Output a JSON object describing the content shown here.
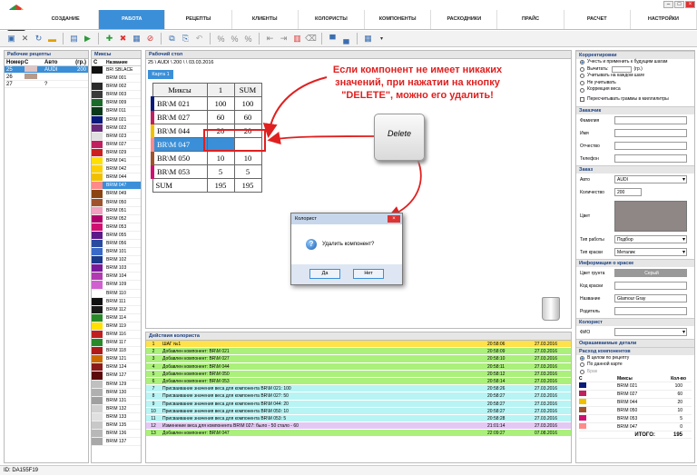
{
  "menu": [
    "СОЗДАНИЕ",
    "РАБОТА",
    "РЕЦЕПТЫ",
    "КЛИЕНТЫ",
    "КОЛОРИСТЫ",
    "КОМПОНЕНТЫ",
    "РАСХОДНИКИ",
    "ПРАЙС",
    "РАСЧЕТ",
    "НАСТРОЙКИ"
  ],
  "recipes": {
    "title": "Рабочие рецепты",
    "headers": [
      "Номер",
      "С",
      "Авто",
      "(гр.)"
    ],
    "rows": [
      {
        "num": "25",
        "auto": "AUDI",
        "g": "200",
        "color": "#e0c4c4"
      },
      {
        "num": "26",
        "auto": "",
        "g": "",
        "color": "#b69a8a"
      },
      {
        "num": "27",
        "auto": "?",
        "g": "",
        "color": "#ffffff"
      }
    ]
  },
  "mixes": {
    "title": "Миксы",
    "headers": [
      "С",
      "Название"
    ],
    "rows": [
      {
        "n": "BR\\ SBLACE",
        "c": "#111111"
      },
      {
        "n": "BR\\M 001",
        "c": "#ffffff"
      },
      {
        "n": "BR\\M 002",
        "c": "#2a2a2a"
      },
      {
        "n": "BR\\M 003",
        "c": "#3a3a3a"
      },
      {
        "n": "BR\\M 009",
        "c": "#1a6b2a"
      },
      {
        "n": "BR\\M 011",
        "c": "#0a3a1a"
      },
      {
        "n": "BR\\M 021",
        "c": "#0a1a7a"
      },
      {
        "n": "BR\\M 022",
        "c": "#6a2a7a"
      },
      {
        "n": "BR\\M 023",
        "c": "#e0e0e0"
      },
      {
        "n": "BR\\M 027",
        "c": "#c02060"
      },
      {
        "n": "BR\\M 029",
        "c": "#cc2020"
      },
      {
        "n": "BR\\M 041",
        "c": "#ffe000"
      },
      {
        "n": "BR\\M 042",
        "c": "#ffd000"
      },
      {
        "n": "BR\\M 044",
        "c": "#f0c000"
      },
      {
        "n": "BR\\M 047",
        "c": "#ff8a8a",
        "sel": true
      },
      {
        "n": "BR\\M 049",
        "c": "#8b4513"
      },
      {
        "n": "BR\\M 050",
        "c": "#a0522d"
      },
      {
        "n": "BR\\M 051",
        "c": "#f0a0c0"
      },
      {
        "n": "BR\\M 052",
        "c": "#b0006a"
      },
      {
        "n": "BR\\M 053",
        "c": "#d01070"
      },
      {
        "n": "BR\\M 055",
        "c": "#5a1a8a"
      },
      {
        "n": "BR\\M 056",
        "c": "#2a4aa0"
      },
      {
        "n": "BR\\M 101",
        "c": "#3a6ac8"
      },
      {
        "n": "BR\\M 102",
        "c": "#1a3a8a"
      },
      {
        "n": "BR\\M 103",
        "c": "#7a1a9a"
      },
      {
        "n": "BR\\M 104",
        "c": "#b03ab0"
      },
      {
        "n": "BR\\M 109",
        "c": "#d060d0"
      },
      {
        "n": "BR\\M 110",
        "c": "#ffffff"
      },
      {
        "n": "BR\\M 111",
        "c": "#111111"
      },
      {
        "n": "BR\\M 112",
        "c": "#1a1a1a"
      },
      {
        "n": "BR\\M 114",
        "c": "#2a8a2a"
      },
      {
        "n": "BR\\M 119",
        "c": "#ffe000"
      },
      {
        "n": "BR\\M 116",
        "c": "#c02020"
      },
      {
        "n": "BR\\M 117",
        "c": "#2a8a2a"
      },
      {
        "n": "BR\\M 118",
        "c": "#b01a1a"
      },
      {
        "n": "BR\\M 121",
        "c": "#cc6a00"
      },
      {
        "n": "BR\\M 124",
        "c": "#8a1a1a"
      },
      {
        "n": "BR\\M 127",
        "c": "#5a0a0a"
      },
      {
        "n": "BR\\M 129",
        "c": "#c0c0c0"
      },
      {
        "n": "BR\\M 130",
        "c": "#b0b0b0"
      },
      {
        "n": "BR\\M 131",
        "c": "#a0a0a0"
      },
      {
        "n": "BR\\M 132",
        "c": "#d0d0d0"
      },
      {
        "n": "BR\\M 133",
        "c": "#e0e0e0"
      },
      {
        "n": "BR\\M 135",
        "c": "#c8c8c8"
      },
      {
        "n": "BR\\M 136",
        "c": "#b8b8b8"
      },
      {
        "n": "BR\\M 137",
        "c": "#a8a8a8"
      }
    ]
  },
  "desk": {
    "title": "Рабочий стол",
    "path": "25 \\ AUDI \\ 200 \\  \\ 03.03.2016",
    "card": "Карта 1",
    "table": {
      "h": [
        "Миксы",
        "1",
        "SUM"
      ],
      "rows": [
        [
          "BR\\M 021",
          "100",
          "100",
          "#0a1a7a"
        ],
        [
          "BR\\M 027",
          "60",
          "60",
          "#c02060"
        ],
        [
          "BR\\M 044",
          "20",
          "20",
          "#f0c000"
        ],
        [
          "BR\\M 047",
          "",
          "",
          "#ff8a8a"
        ],
        [
          "BR\\M 050",
          "10",
          "10",
          "#a0522d"
        ],
        [
          "BR\\M 053",
          "5",
          "5",
          "#d01070"
        ]
      ],
      "sum": [
        "SUM",
        "195",
        "195"
      ]
    }
  },
  "callout": "Если компонент не имеет никаких значений, при нажатии на кнопку \"DELETE\", можно его удалить!",
  "delkey": "Delete",
  "dialog": {
    "title": "Колорист",
    "text": "Удалить компонент?",
    "yes": "Да",
    "no": "Нет"
  },
  "actions": {
    "title": "Действия колориста",
    "rows": [
      [
        "1",
        "ШАГ №1",
        "20:58:06",
        "27.03.2016",
        "#ffe14a"
      ],
      [
        "2",
        "Добавлен компонент: BR\\M 021",
        "20:58:09",
        "27.03.2016",
        "#aaf07a"
      ],
      [
        "3",
        "Добавлен компонент: BR\\M 027",
        "20:58:10",
        "27.03.2016",
        "#aaf07a"
      ],
      [
        "4",
        "Добавлен компонент: BR\\M 044",
        "20:58:11",
        "27.03.2016",
        "#aaf07a"
      ],
      [
        "5",
        "Добавлен компонент: BR\\M 050",
        "20:58:12",
        "27.03.2016",
        "#aaf07a"
      ],
      [
        "6",
        "Добавлен компонент: BR\\M 053",
        "20:58:14",
        "27.03.2016",
        "#aaf07a"
      ],
      [
        "7",
        "Присваивание значения веса для компонента BR\\M 021: 100",
        "20:58:26",
        "27.03.2016",
        "#b8f4f4"
      ],
      [
        "8",
        "Присваивание значения веса для компонента BR\\M 027: 50",
        "20:58:27",
        "27.03.2016",
        "#b8f4f4"
      ],
      [
        "9",
        "Присваивание значения веса для компонента BR\\M 044: 20",
        "20:58:27",
        "27.03.2016",
        "#b8f4f4"
      ],
      [
        "10",
        "Присваивание значения веса для компонента BR\\M 050: 10",
        "20:58:27",
        "27.03.2016",
        "#b8f4f4"
      ],
      [
        "11",
        "Присваивание значения веса для компонента BR\\M 053: 5",
        "20:58:28",
        "27.03.2016",
        "#b8f4f4"
      ],
      [
        "12",
        "Изменение веса для компонента BR\\M 027: было - 50 стало - 60",
        "21:01:14",
        "27.03.2016",
        "#e4c8f4"
      ],
      [
        "13",
        "Добавлен компонент: BR\\M 047",
        "22:09:27",
        "07.08.2016",
        "#aaf07a"
      ]
    ]
  },
  "right": {
    "corr": "Корректировки",
    "opts": [
      "Учесть и применить к будущим шагам",
      "Вычитать:",
      "Учитывать на каждом шаге",
      "Не учитывать",
      "Коррекция веса"
    ],
    "gr": "(гр.)",
    "recalc": "Пересчитывать граммы в миллилитры",
    "cust": "Заказчик",
    "custf": [
      "Фамилия",
      "Имя",
      "Отчество",
      "Телефон"
    ],
    "order": "Заказ",
    "auto_l": "Авто",
    "auto_v": "AUDI",
    "qty_l": "Количество",
    "qty_v": "200",
    "color_l": "Цвет",
    "work_l": "Тип работы",
    "work_v": "Подбор",
    "paint_l": "Тип краски",
    "paint_v": "Металик",
    "info": "Информация о краске",
    "primer_l": "Цвет грунта",
    "primer_v": "Серый",
    "code_l": "Код краски",
    "name_l": "Название",
    "name_v": "Glamour Gray",
    "parent_l": "Родитель",
    "colorist": "Колорист",
    "fio_l": "ФИО",
    "paint_parts": "Окрашиваемые детали",
    "cons": "Расход компонентов",
    "cons_opts": [
      "В целом по рецепту",
      "По данной карте",
      "Брак"
    ],
    "ctab_h": [
      "С",
      "Миксы",
      "Кол-во"
    ],
    "ctab": [
      [
        "BR\\M 021",
        "100",
        "#0a1a7a"
      ],
      [
        "BR\\M 027",
        "60",
        "#c02060"
      ],
      [
        "BR\\M 044",
        "20",
        "#f0c000"
      ],
      [
        "BR\\M 050",
        "10",
        "#a0522d"
      ],
      [
        "BR\\M 053",
        "5",
        "#d01070"
      ],
      [
        "BR\\M 047",
        "0",
        "#ff8a8a"
      ]
    ],
    "total_l": "ИТОГО:",
    "total_v": "195"
  },
  "status": "ID:   DA155F19"
}
